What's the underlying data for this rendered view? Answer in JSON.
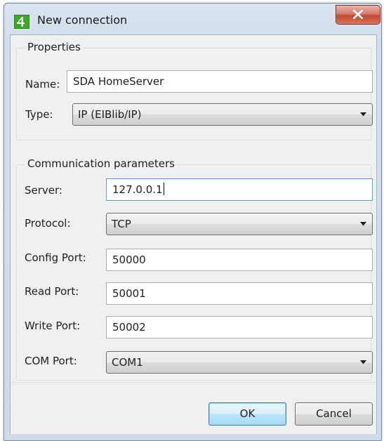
{
  "window": {
    "title": "New connection",
    "icon": "app-logo-icon",
    "close_icon": "close-icon",
    "close_color": "#c9503a"
  },
  "properties": {
    "group_title": "Properties",
    "name_label": "Name:",
    "name_value": "SDA HomeServer",
    "type_label": "Type:",
    "type_value": "IP (EIBlib/IP)"
  },
  "communication": {
    "group_title": "Communication parameters",
    "server_label": "Server:",
    "server_value": "127.0.0.1",
    "protocol_label": "Protocol:",
    "protocol_value": "TCP",
    "config_port_label": "Config Port:",
    "config_port_value": "50000",
    "read_port_label": "Read Port:",
    "read_port_value": "50001",
    "write_port_label": "Write Port:",
    "write_port_value": "50002",
    "com_port_label": "COM Port:",
    "com_port_value": "COM1"
  },
  "buttons": {
    "ok_label": "OK",
    "cancel_label": "Cancel"
  }
}
